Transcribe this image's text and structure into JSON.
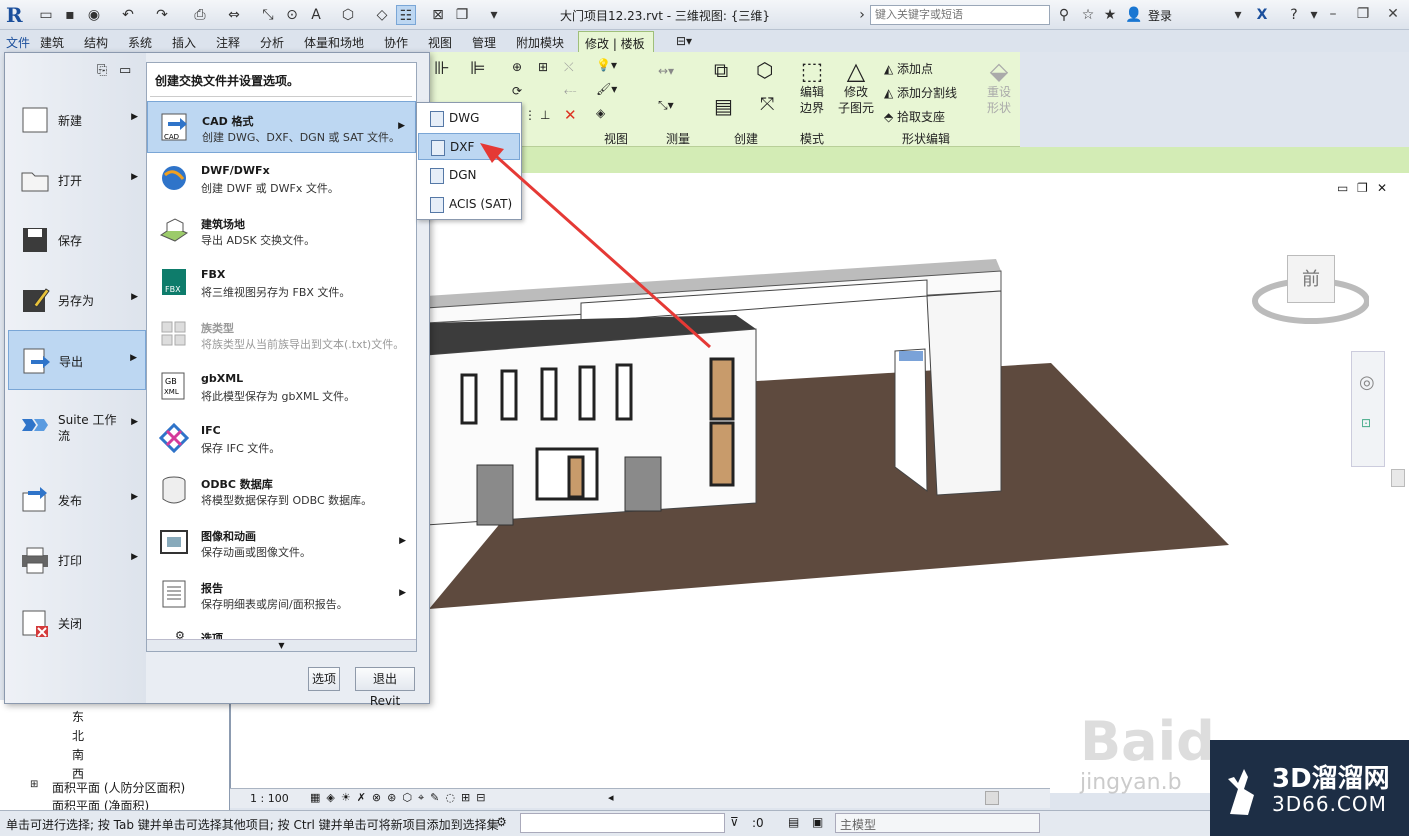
{
  "window": {
    "title": "大门项目12.23.rvt - 三维视图: {三维}",
    "search_placeholder": "键入关键字或短语",
    "login": "登录"
  },
  "ribbon_tabs": [
    "文件",
    "建筑",
    "结构",
    "系统",
    "插入",
    "注释",
    "分析",
    "体量和场地",
    "协作",
    "视图",
    "管理",
    "附加模块",
    "修改 | 楼板"
  ],
  "ribbon": {
    "panels": [
      "视图",
      "测量",
      "创建",
      "模式",
      "形状编辑"
    ],
    "edit_boundary": [
      "编辑",
      "边界"
    ],
    "modify_subelements": [
      "修改",
      "子图元"
    ],
    "add_point": "添加点",
    "add_split_line": "添加分割线",
    "pick_supports": "拾取支座",
    "reset_shape": [
      "重设",
      "形状"
    ]
  },
  "app_menu": {
    "left_items": [
      {
        "label": "新建",
        "icon": "new-icon",
        "has_arrow": true
      },
      {
        "label": "打开",
        "icon": "open-folder-icon",
        "has_arrow": true
      },
      {
        "label": "保存",
        "icon": "save-icon",
        "has_arrow": false
      },
      {
        "label": "另存为",
        "icon": "save-as-icon",
        "has_arrow": true
      },
      {
        "label": "导出",
        "icon": "export-icon",
        "has_arrow": true,
        "active": true
      },
      {
        "label": "Suite 工作流",
        "icon": "suite-workflow-icon",
        "has_arrow": true
      },
      {
        "label": "发布",
        "icon": "publish-icon",
        "has_arrow": true
      },
      {
        "label": "打印",
        "icon": "printer-icon",
        "has_arrow": true
      },
      {
        "label": "关闭",
        "icon": "close-document-icon",
        "has_arrow": false
      }
    ],
    "submenu_header": "创建交换文件并设置选项。",
    "export_items": [
      {
        "title": "CAD 格式",
        "desc": "创建 DWG、DXF、DGN 或 SAT 文件。",
        "icon": "cad-format-icon",
        "has_arrow": true,
        "active": true
      },
      {
        "title": "DWF/DWFx",
        "desc": "创建 DWF 或 DWFx 文件。",
        "icon": "dwf-globe-icon",
        "has_arrow": false
      },
      {
        "title": "建筑场地",
        "desc": "导出 ADSK 交换文件。",
        "icon": "building-site-icon",
        "has_arrow": false
      },
      {
        "title": "FBX",
        "desc": "将三维视图另存为 FBX 文件。",
        "icon": "fbx-icon",
        "has_arrow": false
      },
      {
        "title": "族类型",
        "desc": "将族类型从当前族导出到文本(.txt)文件。",
        "icon": "family-types-icon",
        "has_arrow": false,
        "disabled": true
      },
      {
        "title": "gbXML",
        "desc": "将此模型保存为 gbXML 文件。",
        "icon": "gbxml-icon",
        "has_arrow": false
      },
      {
        "title": "IFC",
        "desc": "保存 IFC 文件。",
        "icon": "ifc-icon",
        "has_arrow": false
      },
      {
        "title": "ODBC 数据库",
        "desc": "将模型数据保存到 ODBC 数据库。",
        "icon": "database-icon",
        "has_arrow": false
      },
      {
        "title": "图像和动画",
        "desc": "保存动画或图像文件。",
        "icon": "film-image-icon",
        "has_arrow": true
      },
      {
        "title": "报告",
        "desc": "保存明细表或房间/面积报告。",
        "icon": "report-icon",
        "has_arrow": true
      },
      {
        "title": "选项",
        "desc": "",
        "icon": "options-icon",
        "has_arrow": false
      }
    ],
    "options_button": "选项",
    "exit_button": "退出 Revit"
  },
  "cad_flyout": [
    {
      "label": "DWG",
      "active": false
    },
    {
      "label": "DXF",
      "active": true
    },
    {
      "label": "DGN",
      "active": false
    },
    {
      "label": "ACIS (SAT)",
      "active": false
    }
  ],
  "project_browser": {
    "items": [
      "东",
      "北",
      "南",
      "西",
      "面积平面 (人防分区面积)",
      "面积平面 (净面积)"
    ]
  },
  "view_control": {
    "scale": "1 : 100"
  },
  "viewcube": {
    "face": "前"
  },
  "status_bar": {
    "message": "单击可进行选择; 按 Tab 键并单击可选择其他项目; 按 Ctrl 键并单击可将新项目添加到选择集",
    "selection_count": ":0",
    "model": "主模型"
  },
  "watermark": {
    "brand": "3D溜溜网",
    "domain": "3D66.COM",
    "baidu": "Baid",
    "baidu_sub": "jingyan.b"
  },
  "colors": {
    "accent": "#bdd7f2",
    "ribbon_context": "#e8f6d4",
    "ground": "#5e4a3e",
    "arrow": "#e53935"
  }
}
